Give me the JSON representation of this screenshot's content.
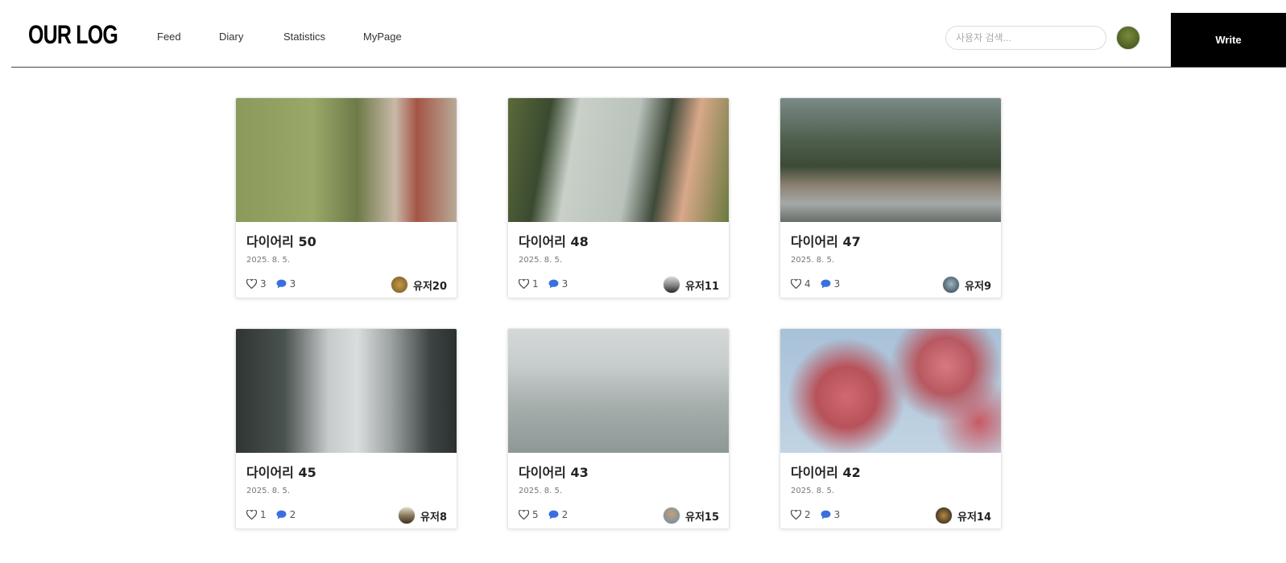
{
  "header": {
    "logo": "OUR LOG",
    "nav": [
      "Feed",
      "Diary",
      "Statistics",
      "MyPage"
    ],
    "search_placeholder": "사용자 검색...",
    "write_label": "Write"
  },
  "icons": {
    "like": "heart-outline-icon",
    "comment": "speech-bubble-icon"
  },
  "colors": {
    "comment_icon": "#3b6fe0",
    "write_button": "#000000"
  },
  "cards": [
    {
      "title": "다이어리 50",
      "date": "2025. 8. 5.",
      "likes": "3",
      "comments": "3",
      "author": "유저20"
    },
    {
      "title": "다이어리 48",
      "date": "2025. 8. 5.",
      "likes": "1",
      "comments": "3",
      "author": "유저11"
    },
    {
      "title": "다이어리 47",
      "date": "2025. 8. 5.",
      "likes": "4",
      "comments": "3",
      "author": "유저9"
    },
    {
      "title": "다이어리 45",
      "date": "2025. 8. 5.",
      "likes": "1",
      "comments": "2",
      "author": "유저8"
    },
    {
      "title": "다이어리 43",
      "date": "2025. 8. 5.",
      "likes": "5",
      "comments": "2",
      "author": "유저15"
    },
    {
      "title": "다이어리 42",
      "date": "2025. 8. 5.",
      "likes": "2",
      "comments": "3",
      "author": "유저14"
    }
  ]
}
